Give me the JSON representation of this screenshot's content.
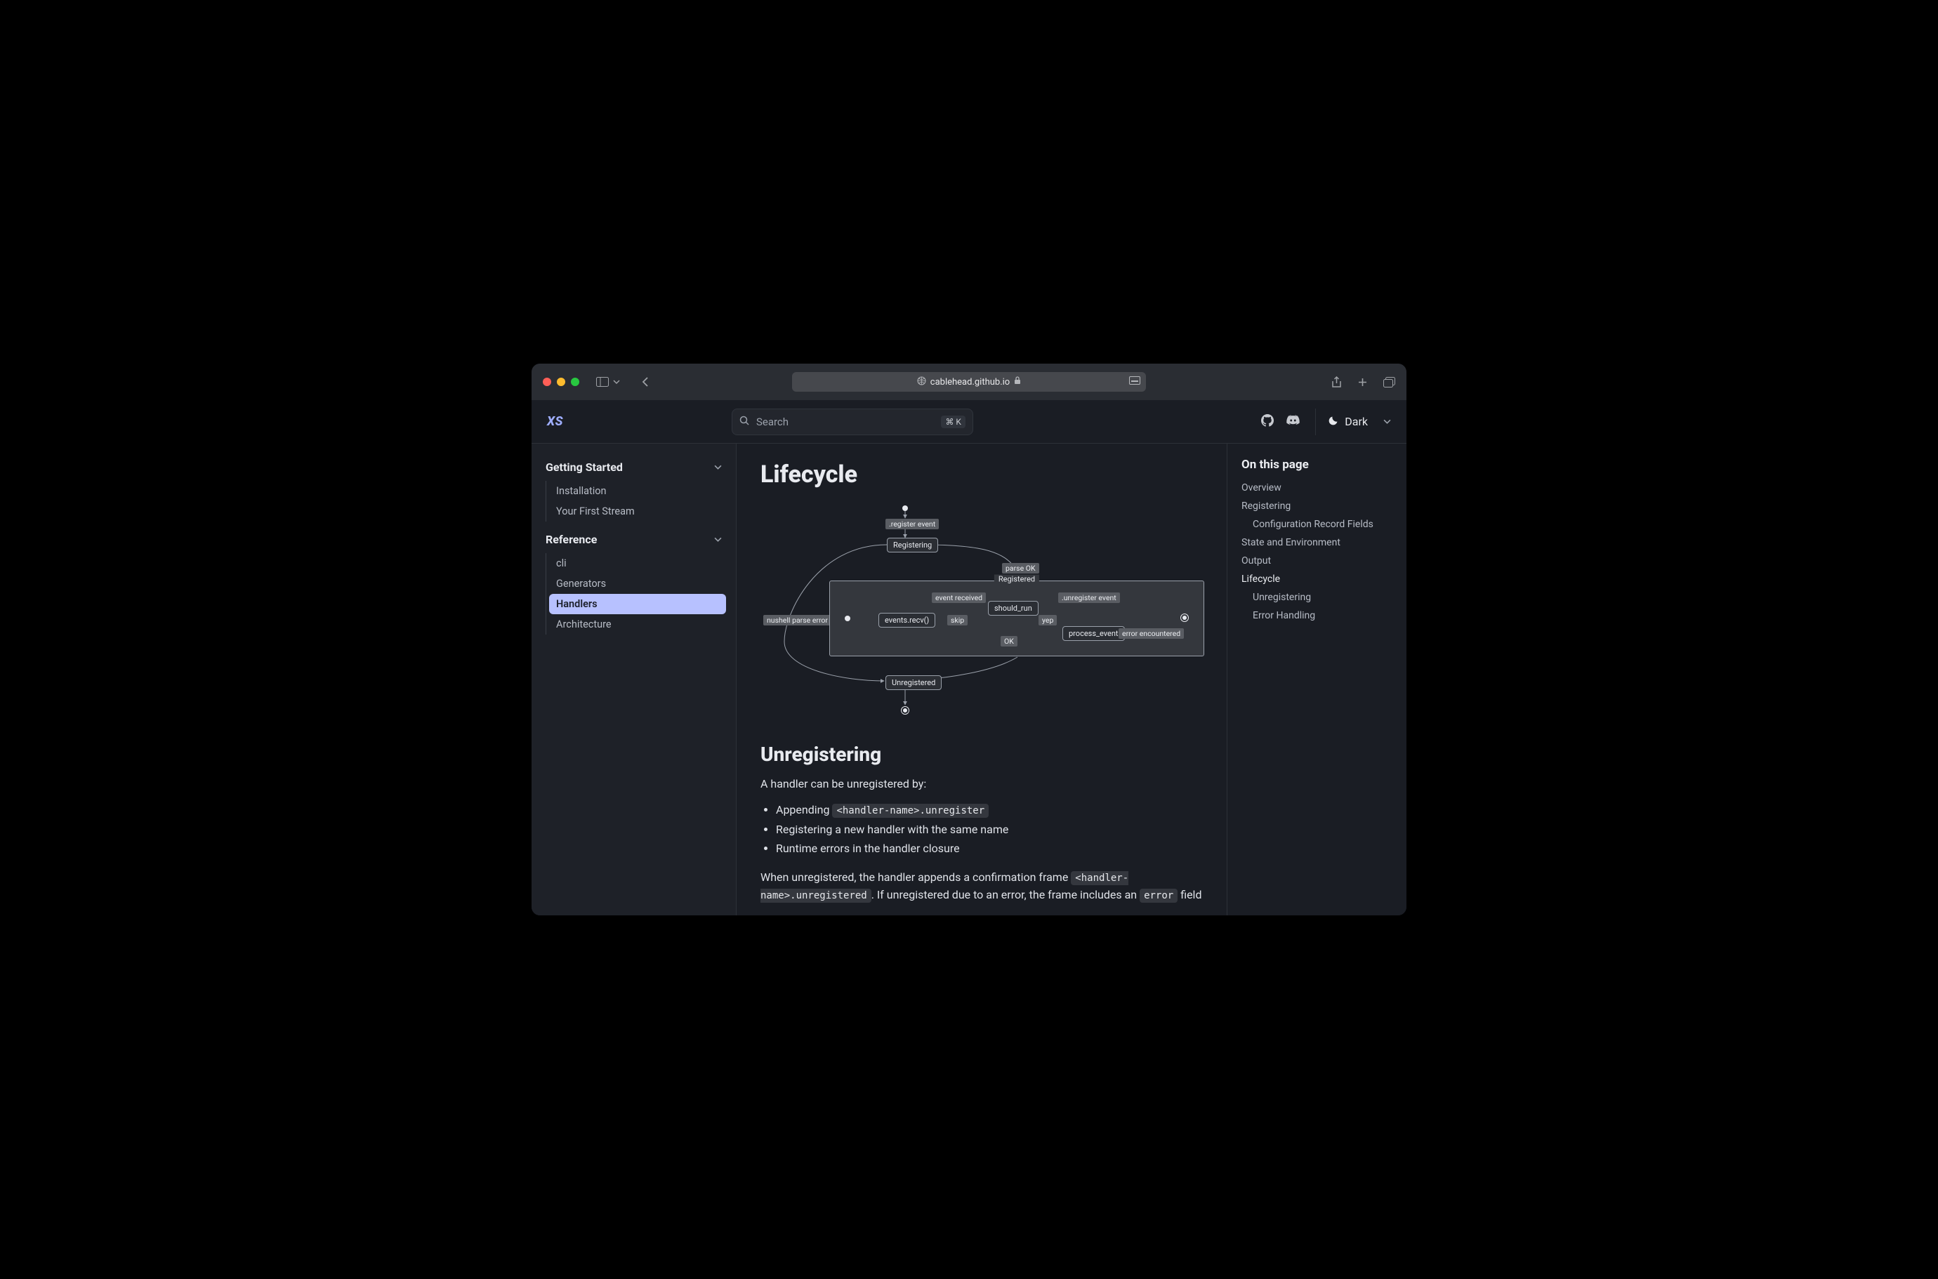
{
  "browser": {
    "url": "cablehead.github.io"
  },
  "brand": "XS",
  "search": {
    "placeholder": "Search",
    "shortcut": "⌘ K"
  },
  "theme": {
    "label": "Dark"
  },
  "sidebar": {
    "sections": [
      {
        "title": "Getting Started",
        "items": [
          {
            "label": "Installation"
          },
          {
            "label": "Your First Stream"
          }
        ]
      },
      {
        "title": "Reference",
        "items": [
          {
            "label": "cli"
          },
          {
            "label": "Generators"
          },
          {
            "label": "Handlers",
            "active": true
          },
          {
            "label": "Architecture"
          }
        ]
      }
    ]
  },
  "page": {
    "h1": "Lifecycle",
    "h2": "Unregistering",
    "p_intro": "A handler can be unregistered by:",
    "bullets": {
      "b1a": "Appending ",
      "b1b": "<handler-name>.unregister",
      "b2": "Registering a new handler with the same name",
      "b3": "Runtime errors in the handler closure"
    },
    "p_after_a": "When unregistered, the handler appends a confirmation frame ",
    "p_after_code": "<handler-name>.unregistered",
    "p_after_b": ". If unregistered due to an error, the frame includes an ",
    "p_after_code2": "error",
    "p_after_c": " field"
  },
  "diagram": {
    "register_event": ".register event",
    "registering": "Registering",
    "parse_ok": "parse OK",
    "nushell_parse_error": "nushell parse error",
    "registered": "Registered",
    "events_recv": "events.recv()",
    "event_received": "event received",
    "should_run": "should_run",
    "skip": "skip",
    "yep": "yep",
    "unregister_event": ".unregister event",
    "process_event": "process_event",
    "error_encountered": "error encountered",
    "ok": "OK",
    "unregistered": "Unregistered"
  },
  "toc": {
    "title": "On this page",
    "items": [
      {
        "label": "Overview"
      },
      {
        "label": "Registering"
      },
      {
        "label": "Configuration Record Fields",
        "sub": true
      },
      {
        "label": "State and Environment"
      },
      {
        "label": "Output"
      },
      {
        "label": "Lifecycle",
        "active": true
      },
      {
        "label": "Unregistering",
        "sub": true
      },
      {
        "label": "Error Handling",
        "sub": true
      }
    ]
  }
}
